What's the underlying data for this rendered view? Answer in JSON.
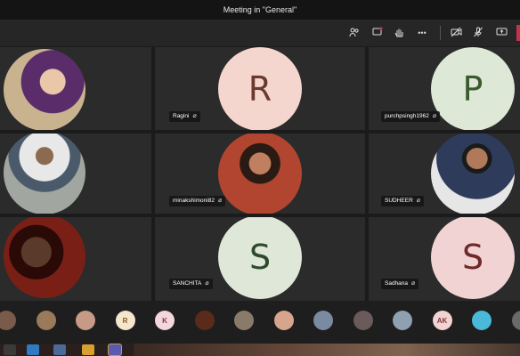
{
  "window": {
    "title": "Meeting in \"General\""
  },
  "toolbar": {
    "icons": [
      "participants-icon",
      "chat-icon",
      "raise-hand-icon",
      "more-actions-icon",
      "camera-off-icon",
      "mic-off-icon",
      "share-screen-icon"
    ],
    "more_label": "•••"
  },
  "participants": [
    {
      "id": "p1",
      "name": "",
      "type": "photo",
      "color": "#c9b38f"
    },
    {
      "id": "p2",
      "name": "Ragini",
      "type": "initial",
      "initial": "R",
      "bg": "#f4d6cf",
      "fg": "#6b3a2e"
    },
    {
      "id": "p3",
      "name": "purchpsingh1962",
      "type": "initial",
      "initial": "P",
      "bg": "#dde8d6",
      "fg": "#3a5a2e"
    },
    {
      "id": "p4",
      "name": "",
      "type": "photo",
      "color": "#a1a6a0"
    },
    {
      "id": "p5",
      "name": "minakshimoni82",
      "type": "photo",
      "color": "#b2452f"
    },
    {
      "id": "p6",
      "name": "SUDHEER",
      "type": "photo",
      "color": "#2e3b5a"
    },
    {
      "id": "p7",
      "name": "",
      "type": "photo",
      "color": "#7a1f16"
    },
    {
      "id": "p8",
      "name": "SANCHITA",
      "type": "initial",
      "initial": "S",
      "bg": "#dfe7d9",
      "fg": "#2f4a2a"
    },
    {
      "id": "p9",
      "name": "Sadhana",
      "type": "initial",
      "initial": "S",
      "bg": "#f2d3d3",
      "fg": "#6e2a2a"
    }
  ],
  "strip": [
    {
      "label": "",
      "bg": "#7a5a4a"
    },
    {
      "label": "",
      "bg": "#9a7a5a"
    },
    {
      "label": "",
      "bg": "#c79a86"
    },
    {
      "label": "R",
      "bg": "#f6e6cc",
      "fg": "#7a5a2a"
    },
    {
      "label": "K",
      "bg": "#f4d6dd",
      "fg": "#7a3a4a"
    },
    {
      "label": "",
      "bg": "#5a2a1a"
    },
    {
      "label": "",
      "bg": "#8a7a6a"
    },
    {
      "label": "",
      "bg": "#d7a58e"
    },
    {
      "label": "",
      "bg": "#7a8aa0"
    },
    {
      "label": "",
      "bg": "#6a5a5a"
    },
    {
      "label": "",
      "bg": "#8fa0b0"
    },
    {
      "label": "AK",
      "bg": "#f2d2d2",
      "fg": "#7a3a3a"
    },
    {
      "label": "",
      "bg": "#4ab8d8"
    },
    {
      "label": "",
      "bg": "#6a6a6a"
    }
  ],
  "mic_glyph": "🎙"
}
